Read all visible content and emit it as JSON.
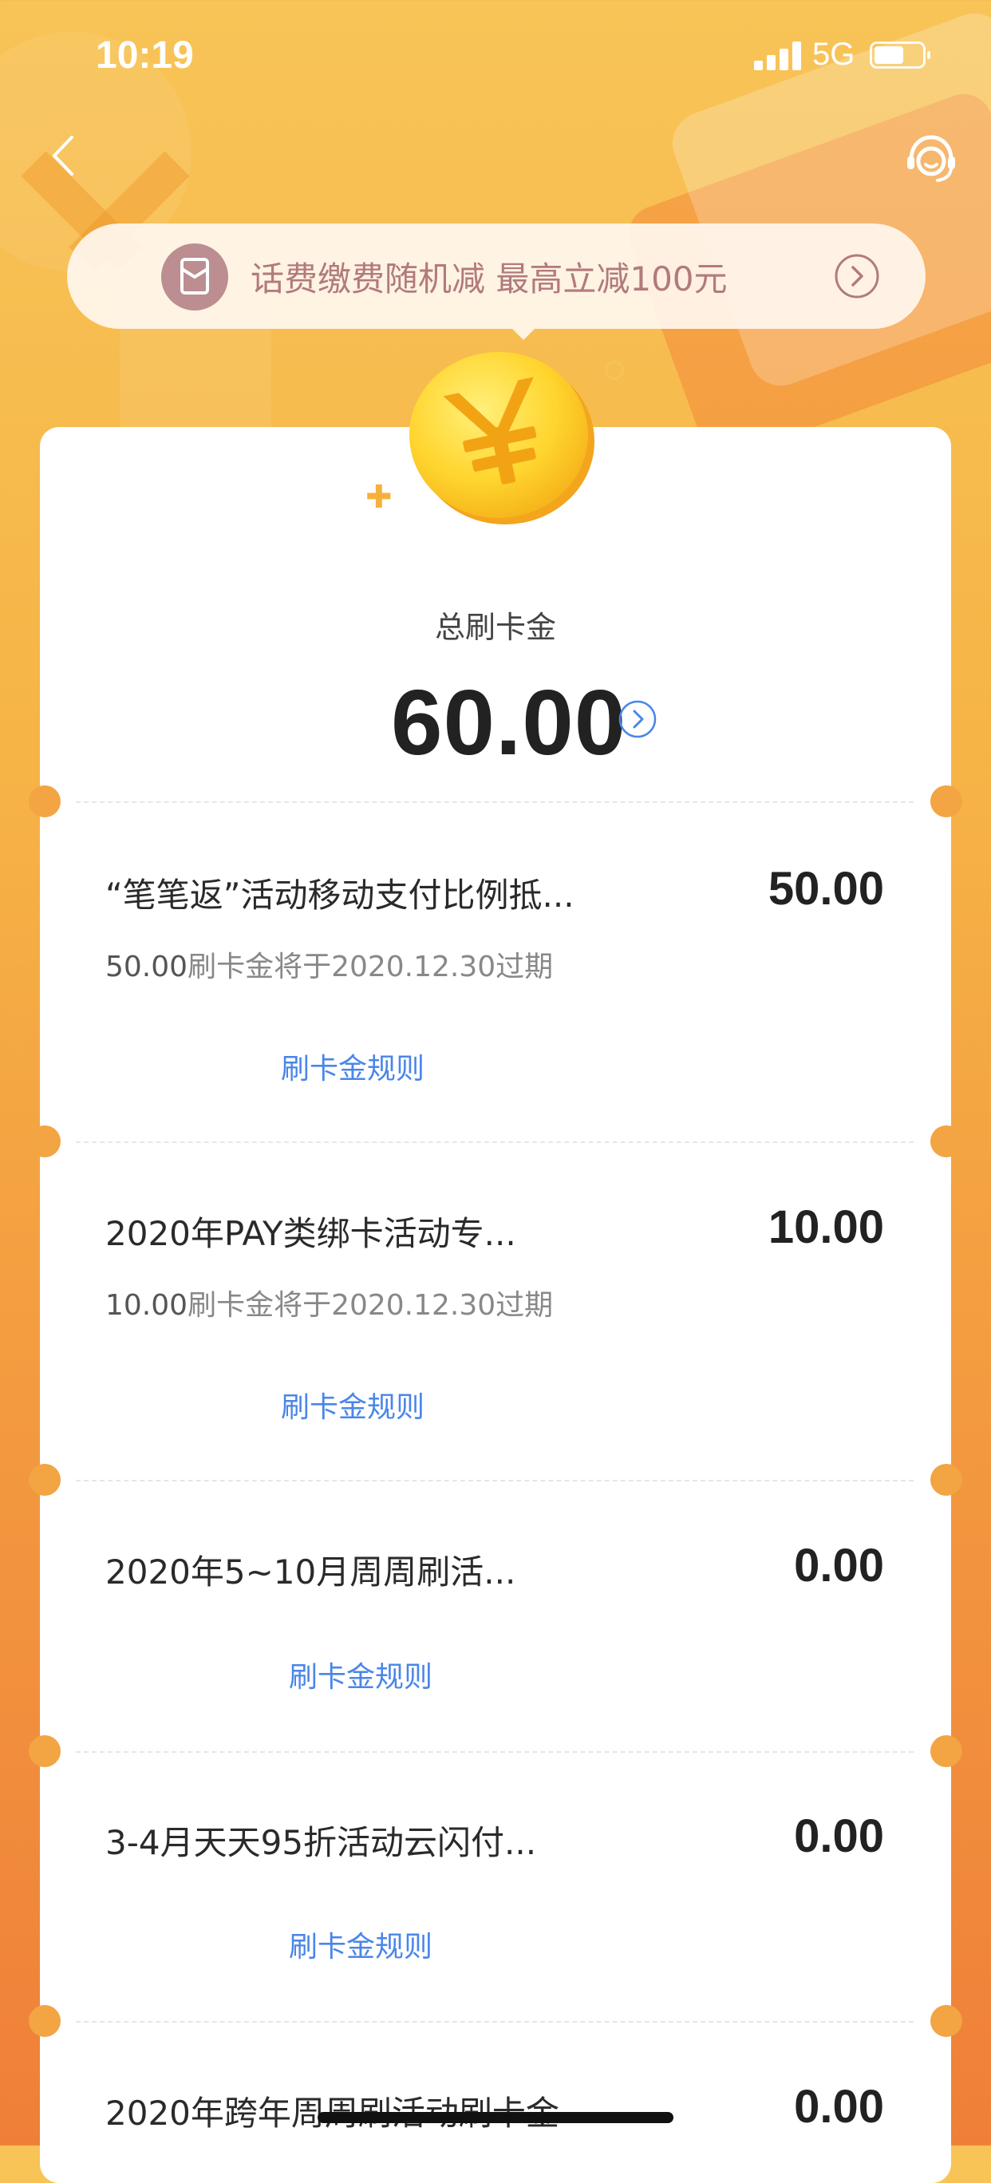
{
  "status_bar": {
    "time": "10:19",
    "network": "5G"
  },
  "nav": {
    "back_icon": "chevron-left-icon",
    "service_icon": "customer-service-icon"
  },
  "promo_banner": {
    "text": "话费缴费随机减 最高立减100元",
    "icon": "red-envelope-icon",
    "arrow_icon": "chevron-right-circle-icon"
  },
  "summary": {
    "label": "总刷卡金",
    "value": "60.00",
    "coin_icon": "yen-coin-icon"
  },
  "items": [
    {
      "title": "“笔笔返”活动移动支付比例抵...",
      "amount": "50.00",
      "expiry_amount": "50.00",
      "expiry_text": "刷卡金将于2020.12.30过期",
      "rules_label": "刷卡金规则"
    },
    {
      "title": "2020年PAY类绑卡活动专...",
      "amount": "10.00",
      "expiry_amount": "10.00",
      "expiry_text": "刷卡金将于2020.12.30过期",
      "rules_label": "刷卡金规则"
    },
    {
      "title": "2020年5~10月周周刷活...",
      "amount": "0.00",
      "rules_label": "刷卡金规则"
    },
    {
      "title": "3-4月天天95折活动云闪付...",
      "amount": "0.00",
      "rules_label": "刷卡金规则"
    },
    {
      "title": "2020年跨年周周刷活动刷卡金",
      "amount": "0.00"
    }
  ],
  "colors": {
    "bg_top": "#f8c457",
    "bg_bottom": "#ef7f38",
    "link": "#4a86e8",
    "banner_text": "#b27a7d"
  }
}
